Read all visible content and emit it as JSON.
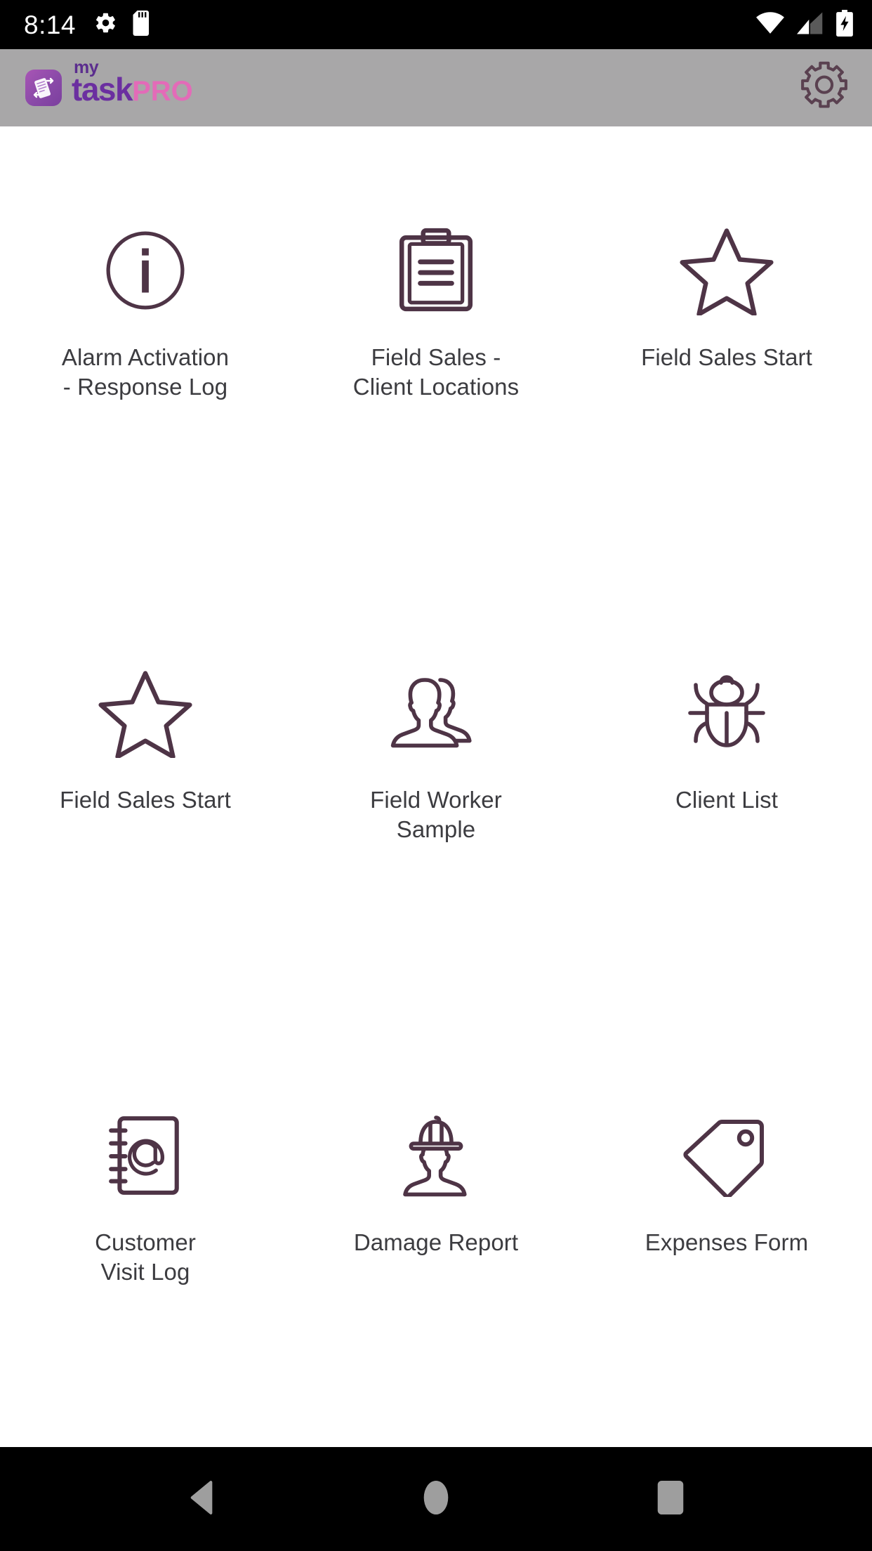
{
  "status_bar": {
    "time": "8:14",
    "left_icons": [
      "gear-icon",
      "sd-card-icon"
    ],
    "right_icons": [
      "wifi-icon",
      "cellular-signal-icon",
      "battery-charging-icon"
    ],
    "background": "#000000",
    "foreground": "#ffffff"
  },
  "header": {
    "logo_my": "my",
    "logo_task": "task",
    "logo_pro": "PRO",
    "settings_icon": "gear-icon",
    "background": "#a8a7a8",
    "logo_purple": "#6b2fa0",
    "logo_pink": "#e36bb8"
  },
  "grid": {
    "icon_color": "#4e3446",
    "label_color": "#3c3c40",
    "items": [
      {
        "label": "Alarm Activation\n- Response Log",
        "label_line1": "Alarm Activation",
        "label_line2": "- Response Log",
        "icon": "info-circle-icon"
      },
      {
        "label": "Field Sales -\nClient Locations",
        "label_line1": "Field Sales -",
        "label_line2": "Client Locations",
        "icon": "clipboard-icon"
      },
      {
        "label": "Field Sales Start",
        "label_line1": "Field Sales Start",
        "label_line2": "",
        "icon": "star-icon"
      },
      {
        "label": "Field Sales Start",
        "label_line1": "Field Sales Start",
        "label_line2": "",
        "icon": "star-icon"
      },
      {
        "label": "Field Worker\nSample",
        "label_line1": "Field Worker",
        "label_line2": "Sample",
        "icon": "users-icon"
      },
      {
        "label": "Client List",
        "label_line1": "Client List",
        "label_line2": "",
        "icon": "bug-icon"
      },
      {
        "label": "Customer\nVisit Log",
        "label_line1": "Customer",
        "label_line2": "Visit Log",
        "icon": "address-book-icon"
      },
      {
        "label": "Damage Report",
        "label_line1": "Damage Report",
        "label_line2": "",
        "icon": "worker-helmet-icon"
      },
      {
        "label": "Expenses Form",
        "label_line1": "Expenses Form",
        "label_line2": "",
        "icon": "price-tag-icon"
      }
    ]
  },
  "nav_bar": {
    "buttons": [
      "back-nav-icon",
      "home-nav-icon",
      "recents-nav-icon"
    ],
    "background": "#000000",
    "icon_color": "#9e9e9e"
  }
}
